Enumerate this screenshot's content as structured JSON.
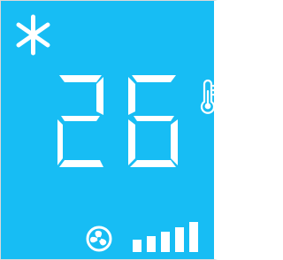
{
  "display": {
    "background_color": "#17bdf4",
    "segment_color": "#ffffff",
    "mode_icon": "snowflake-icon",
    "temperature": "26",
    "thermometer_icon": "thermometer-icon",
    "fan_icon": "fan-icon",
    "fan_speed_level": 5,
    "fan_speed_max": 5
  }
}
